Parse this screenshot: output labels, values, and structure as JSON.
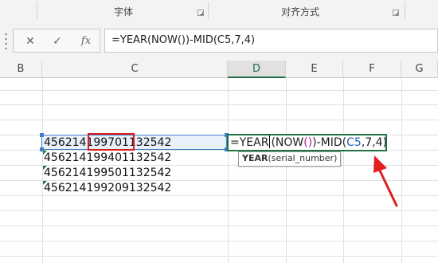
{
  "ribbon": {
    "groups": [
      {
        "label": "字体"
      },
      {
        "label": "对齐方式"
      }
    ]
  },
  "formula_bar": {
    "cancel_glyph": "✕",
    "enter_glyph": "✓",
    "insert_function_glyph": "fx",
    "formula": "=YEAR(NOW())-MID(C5,7,4)"
  },
  "columns": [
    "B",
    "C",
    "D",
    "E",
    "F",
    "G"
  ],
  "active_column": "D",
  "cells": {
    "C5": "45621419970113254 2",
    "C6": "456214199401132542",
    "C7": "456214199501132542",
    "C8": "456214199209132542"
  },
  "c5_parts": {
    "before": "456214",
    "highlight": "19970113",
    "after": "2542"
  },
  "c5_full_after_highlight": "2542",
  "edit": {
    "part1": "=YEAR",
    "part2": "(NOW",
    "part3": "()",
    "part4": ")-MID(",
    "ref": "C5",
    "part5": ",7,4)"
  },
  "tooltip": {
    "function_name": "YEAR",
    "args": "(serial_number)"
  },
  "colors": {
    "selection_border": "#3d7fc4",
    "edit_border": "#217346",
    "highlight_border": "#d81e1e",
    "arrow": "#e02020",
    "reference_blue": "#1f5fb4"
  }
}
